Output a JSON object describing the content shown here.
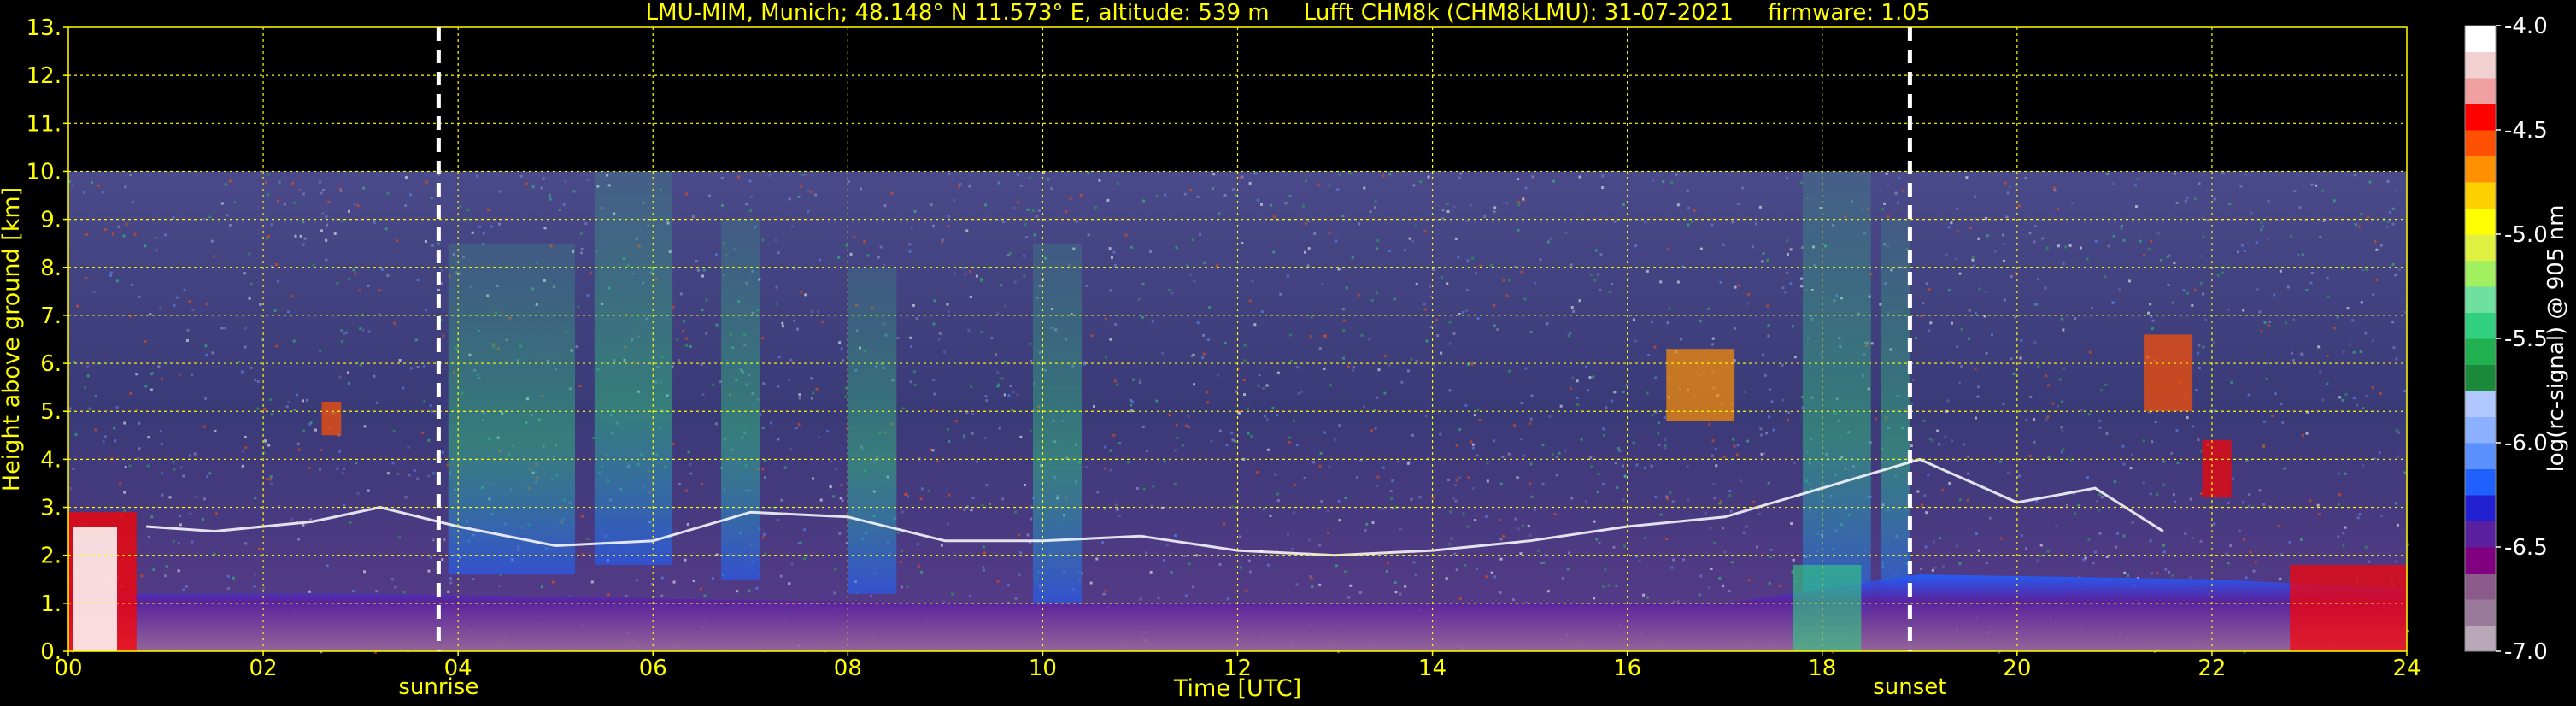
{
  "header": {
    "site": "LMU-MIM, Munich; 48.148° N 11.573° E, altitude: 539 m",
    "instrument": "Lufft CHM8k (CHM8kLMU): 31-07-2021",
    "firmware": "firmware: 1.05"
  },
  "chart_data": {
    "type": "heatmap",
    "xlabel": "Time [UTC]",
    "ylabel": "Height above ground [km]",
    "xlim": [
      0,
      24
    ],
    "ylim": [
      0,
      13
    ],
    "x_ticks": [
      "00",
      "02",
      "04",
      "06",
      "08",
      "10",
      "12",
      "14",
      "16",
      "18",
      "20",
      "22",
      "24"
    ],
    "y_ticks": [
      "0.",
      "1.",
      "2.",
      "3.",
      "4.",
      "5.",
      "6.",
      "7.",
      "8.",
      "9.",
      "10.",
      "11.",
      "12.",
      "13."
    ],
    "grid": true,
    "data_top_km": 10.0,
    "events": [
      {
        "label": "sunrise",
        "time_utc": 3.8
      },
      {
        "label": "sunset",
        "time_utc": 18.9
      }
    ],
    "colorbar": {
      "label": "log(rc-signal) @ 905 nm",
      "range": [
        -7.0,
        -4.0
      ],
      "ticks": [
        "-4.0",
        "-4.5",
        "-5.0",
        "-5.5",
        "-6.0",
        "-6.5",
        "-7.0"
      ],
      "colors": [
        "#b8a8b8",
        "#9a7a9a",
        "#8a5a8a",
        "#800080",
        "#5a20a0",
        "#2020d0",
        "#2060ff",
        "#5a90ff",
        "#8ab0ff",
        "#b0c8ff",
        "#1a8a3a",
        "#20b050",
        "#30d080",
        "#70e0a0",
        "#a0f060",
        "#e0f040",
        "#ffff00",
        "#ffd000",
        "#ff9000",
        "#ff5000",
        "#ff0000",
        "#f0a0a0",
        "#f0d0d0",
        "#ffffff"
      ]
    },
    "cloud_base_km": [
      {
        "t": 0.8,
        "h": 2.6
      },
      {
        "t": 1.5,
        "h": 2.5
      },
      {
        "t": 2.5,
        "h": 2.7
      },
      {
        "t": 3.2,
        "h": 3.0
      },
      {
        "t": 4.0,
        "h": 2.6
      },
      {
        "t": 5.0,
        "h": 2.2
      },
      {
        "t": 6.0,
        "h": 2.3
      },
      {
        "t": 7.0,
        "h": 2.9
      },
      {
        "t": 8.0,
        "h": 2.8
      },
      {
        "t": 9.0,
        "h": 2.3
      },
      {
        "t": 10.0,
        "h": 2.3
      },
      {
        "t": 11.0,
        "h": 2.4
      },
      {
        "t": 12.0,
        "h": 2.1
      },
      {
        "t": 13.0,
        "h": 2.0
      },
      {
        "t": 14.0,
        "h": 2.1
      },
      {
        "t": 15.0,
        "h": 2.3
      },
      {
        "t": 16.0,
        "h": 2.6
      },
      {
        "t": 17.0,
        "h": 2.8
      },
      {
        "t": 19.0,
        "h": 4.0
      },
      {
        "t": 20.0,
        "h": 3.1
      },
      {
        "t": 20.8,
        "h": 3.4
      },
      {
        "t": 21.5,
        "h": 2.5
      }
    ]
  }
}
